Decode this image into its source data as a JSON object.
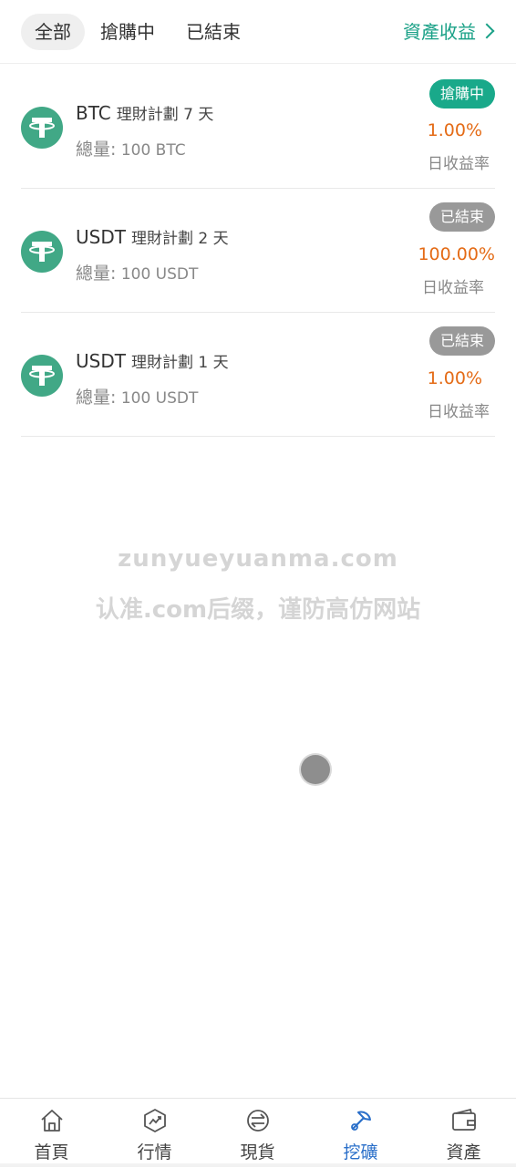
{
  "tabs": {
    "all": "全部",
    "buying": "搶購中",
    "ended": "已結束",
    "asset_link": "資產收益"
  },
  "items": [
    {
      "coin": "BTC",
      "plan": "理財計劃 7 天",
      "total_label": "總量:",
      "total_value": "100 BTC",
      "status": "搶購中",
      "rate": "1.00%",
      "rate_label": "日收益率"
    },
    {
      "coin": "USDT",
      "plan": "理財計劃 2 天",
      "total_label": "總量:",
      "total_value": "100 USDT",
      "status": "已結束",
      "rate": "100.00%",
      "rate_label": "日收益率"
    },
    {
      "coin": "USDT",
      "plan": "理財計劃 1 天",
      "total_label": "總量:",
      "total_value": "100 USDT",
      "status": "已結束",
      "rate": "1.00%",
      "rate_label": "日收益率"
    }
  ],
  "watermark": {
    "line1": "zunyueyuanma.com",
    "line2": "认准.com后缀，谨防高仿网站"
  },
  "nav": {
    "home": "首頁",
    "market": "行情",
    "spot": "現貨",
    "mining": "挖礦",
    "assets": "資產"
  },
  "colors": {
    "accent_green": "#19a98a",
    "rate_orange": "#e46b16",
    "active_blue": "#2a6fc9",
    "badge_gray": "#999999",
    "coin_green": "#41a886"
  },
  "icons": {
    "coin": "tether-icon",
    "asset_link": "chevron-right-icon",
    "home": "home-icon",
    "market": "trend-chart-icon",
    "spot": "exchange-icon",
    "mining": "pickaxe-icon",
    "assets": "wallet-icon"
  }
}
